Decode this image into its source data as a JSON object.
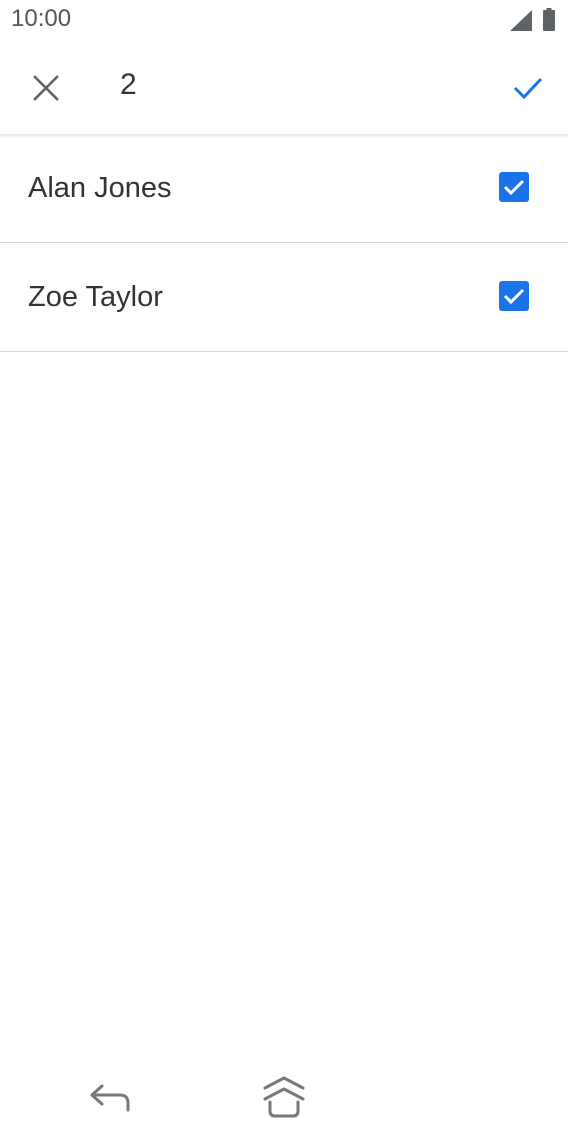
{
  "status_bar": {
    "time": "10:00",
    "icons": [
      "signal-icon",
      "battery-icon"
    ]
  },
  "app_bar": {
    "close_icon": "close-icon",
    "selection_count": "2",
    "confirm_icon": "check-icon"
  },
  "colors": {
    "accent": "#1a73e8",
    "text_primary": "#333333",
    "icon_gray": "#5f6368"
  },
  "list": {
    "items": [
      {
        "name": "Alan Jones",
        "checked": true
      },
      {
        "name": "Zoe Taylor",
        "checked": true
      }
    ]
  },
  "nav_bar": {
    "back_icon": "back-icon",
    "home_icon": "home-icon"
  }
}
